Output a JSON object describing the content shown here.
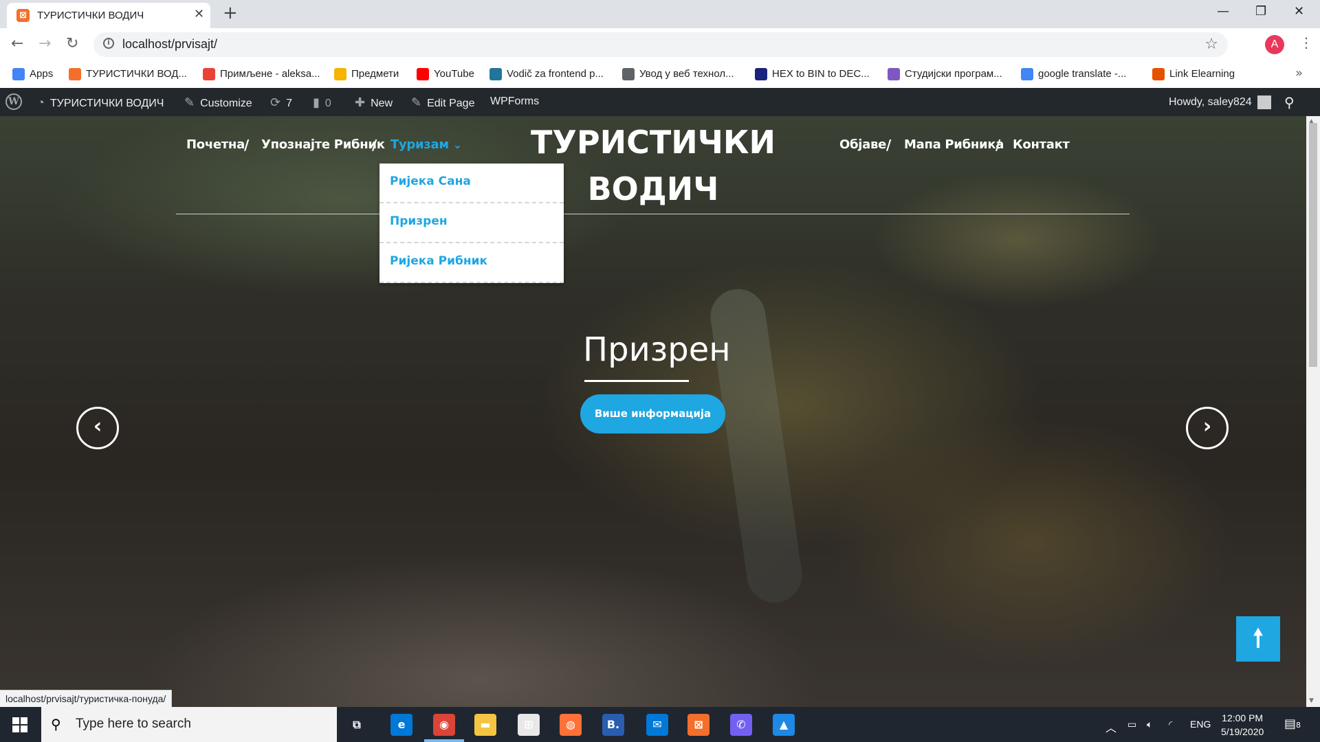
{
  "browser": {
    "tab_title": "ТУРИСТИЧКИ ВОДИЧ",
    "tab_close": "✕",
    "new_tab": "+",
    "url": "localhost/prvisajt/",
    "profile_initial": "A",
    "window_controls": [
      "—",
      "❐",
      "✕"
    ]
  },
  "bookmarks": [
    {
      "label": "Apps",
      "icon": "apps-grid-icon",
      "color": "#4285f4"
    },
    {
      "label": "ТУРИСТИЧКИ ВОД...",
      "icon": "xampp-icon",
      "color": "#f36f2b"
    },
    {
      "label": "Примљене - aleksa...",
      "icon": "gmail-icon",
      "color": "#ea4335"
    },
    {
      "label": "Предмети",
      "icon": "folder-user-icon",
      "color": "#f4b400"
    },
    {
      "label": "YouTube",
      "icon": "youtube-icon",
      "color": "#ff0000"
    },
    {
      "label": "Vodič za frontend p...",
      "icon": "wordpress-icon",
      "color": "#21759b"
    },
    {
      "label": "Увод у веб технол...",
      "icon": "globe-icon",
      "color": "#5f6368"
    },
    {
      "label": "HEX to BIN to DEC...",
      "icon": "hex-converter-icon",
      "color": "#1a237e"
    },
    {
      "label": "Студијски програм...",
      "icon": "university-icon",
      "color": "#7e57c2"
    },
    {
      "label": "google translate -...",
      "icon": "google-icon",
      "color": "#4285f4"
    },
    {
      "label": "Link Elearning",
      "icon": "elearning-icon",
      "color": "#e65100"
    }
  ],
  "admin_bar": {
    "site_name": "ТУРИСТИЧКИ ВОДИЧ",
    "customize": "Customize",
    "updates": "7",
    "comments": "0",
    "new": "New",
    "edit_page": "Edit Page",
    "wpforms": "WPForms",
    "howdy": "Howdy, saley824"
  },
  "site": {
    "title_line1": "ТУРИСТИЧКИ",
    "title_line2": "ВОДИЧ",
    "nav_left": [
      "Почетна",
      "Упознајте Рибник",
      "Туризам"
    ],
    "nav_right": [
      "Објаве",
      "Мапа Рибника",
      "Контакт"
    ],
    "separator": "/",
    "dropdown": [
      "Ријека Сана",
      "Призрен",
      "Ријека Рибник"
    ],
    "dropdown_caret": "⌄"
  },
  "slide": {
    "title": "Призрен",
    "button": "Више информација",
    "prev": "‹",
    "next": "›",
    "to_top": "🠕"
  },
  "status_url": "localhost/prvisajt/туристичка-понуда/",
  "taskbar": {
    "search_placeholder": "Type here to search",
    "apps": [
      {
        "name": "task-view-icon",
        "glyph": "⧉",
        "color": "transparent"
      },
      {
        "name": "edge-icon",
        "glyph": "e",
        "color": "#0078d7"
      },
      {
        "name": "chrome-icon",
        "glyph": "◉",
        "color": "#db4437"
      },
      {
        "name": "file-explorer-icon",
        "glyph": "▬",
        "color": "#f4c542"
      },
      {
        "name": "store-icon",
        "glyph": "⊞",
        "color": "#e8e8e8"
      },
      {
        "name": "firefox-icon",
        "glyph": "◍",
        "color": "#ff7139"
      },
      {
        "name": "bootstrap-studio-icon",
        "glyph": "B.",
        "color": "#2a5db0"
      },
      {
        "name": "mail-icon",
        "glyph": "✉",
        "color": "#0078d7"
      },
      {
        "name": "xampp-icon",
        "glyph": "⊠",
        "color": "#f36f2b"
      },
      {
        "name": "viber-icon",
        "glyph": "✆",
        "color": "#7360f2"
      },
      {
        "name": "photos-icon",
        "glyph": "▲",
        "color": "#1e88e5"
      }
    ],
    "language": "ENG",
    "time": "12:00 PM",
    "date": "5/19/2020",
    "notifications": "8"
  },
  "colors": {
    "accent": "#1ea7e1",
    "admin_bar": "#23282d",
    "taskbar": "#1f2630"
  }
}
